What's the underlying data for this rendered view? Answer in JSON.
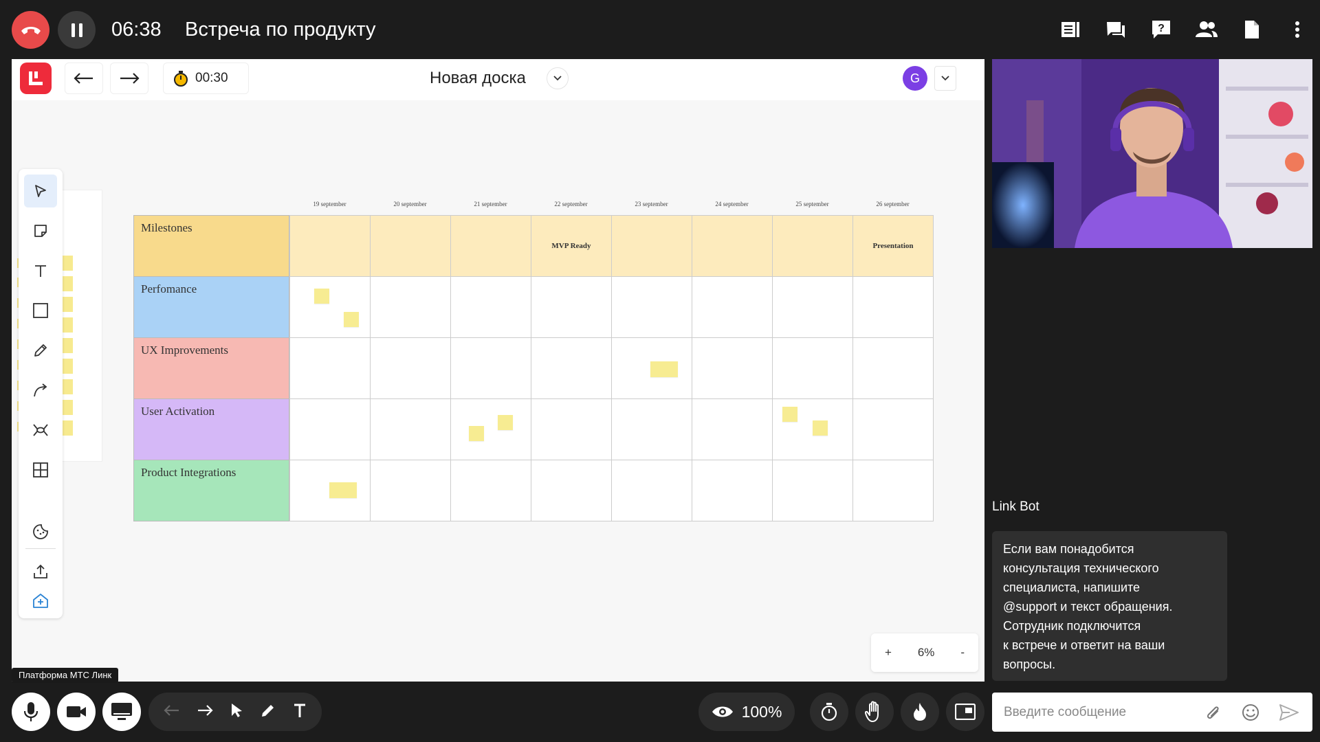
{
  "topbar": {
    "elapsed": "06:38",
    "meeting_title": "Встреча по продукту"
  },
  "board": {
    "title": "Новая доска",
    "timer": "00:30",
    "avatar_letter": "G",
    "zoom": "6%",
    "zoom_in": "+",
    "zoom_out": "-"
  },
  "grid": {
    "dates": [
      "19 september",
      "20 september",
      "21 september",
      "22 september",
      "23 september",
      "24 september",
      "25 september",
      "26 september"
    ],
    "rows": [
      {
        "label": "Milestones",
        "color": "#f8da8c"
      },
      {
        "label": "Perfomance",
        "color": "#aad2f6"
      },
      {
        "label": "UX Improvements",
        "color": "#f7b9b3"
      },
      {
        "label": "User Activation",
        "color": "#d5b8f7"
      },
      {
        "label": "Product Integrations",
        "color": "#a6e6ba"
      }
    ],
    "milestones": {
      "mvp": "MVP Ready",
      "presentation": "Presentation"
    }
  },
  "platform_label": "Платформа МТС Линк",
  "chat": {
    "sender": "Link Bot",
    "lines": [
      "Если вам понадобится",
      "консультация технического",
      "специалиста, напишите",
      "@support и текст обращения.",
      "Сотрудник подключится",
      "к встрече и ответит на ваши",
      "вопросы."
    ],
    "placeholder": "Введите сообщение"
  },
  "bottombar": {
    "view_percent": "100%"
  },
  "colors": {
    "hangup": "#e84a4a",
    "accent_purple": "#7b3fe4",
    "logo_red": "#ee2b3b",
    "sticky": "#f7ec92"
  }
}
